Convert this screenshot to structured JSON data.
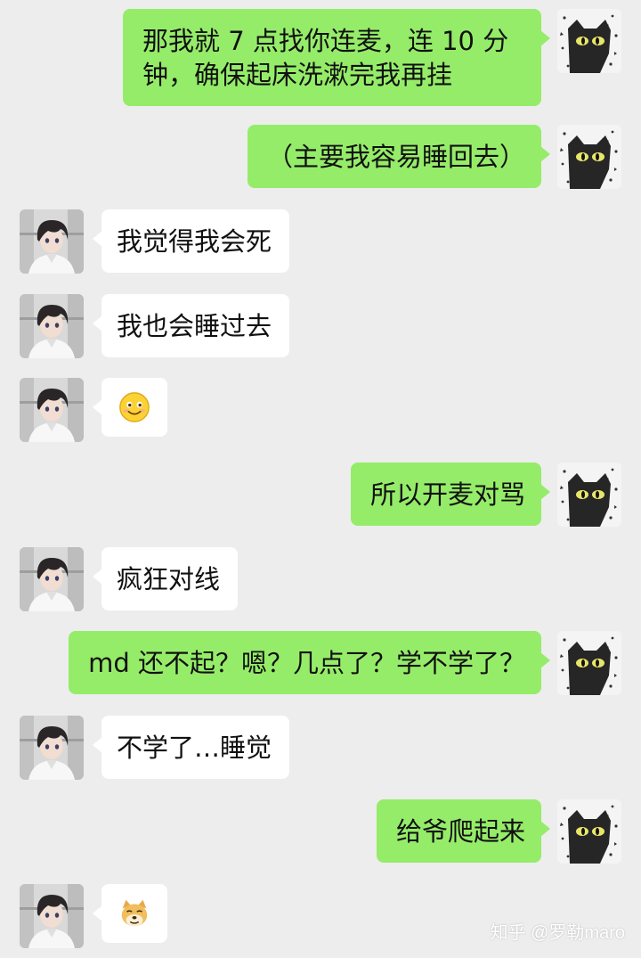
{
  "app": {
    "background": "#ededed",
    "sent_bubble_color": "#95ec69",
    "received_bubble_color": "#ffffff"
  },
  "messages": [
    {
      "side": "me",
      "avatar": "cat-avatar",
      "text": "那我就 7 点找你连麦，连 10 分钟，确保起床洗漱完我再挂"
    },
    {
      "side": "me",
      "avatar": "cat-avatar",
      "text": "（主要我容易睡回去）"
    },
    {
      "side": "other",
      "avatar": "anime-boy-avatar",
      "text": "我觉得我会死"
    },
    {
      "side": "other",
      "avatar": "anime-boy-avatar",
      "text": "我也会睡过去"
    },
    {
      "side": "other",
      "avatar": "anime-boy-avatar",
      "emoji": "smile-emoji"
    },
    {
      "side": "me",
      "avatar": "cat-avatar",
      "text": "所以开麦对骂"
    },
    {
      "side": "other",
      "avatar": "anime-boy-avatar",
      "text": "疯狂对线"
    },
    {
      "side": "me",
      "avatar": "cat-avatar",
      "text": "md 还不起？嗯？几点了？学不学了？"
    },
    {
      "side": "other",
      "avatar": "anime-boy-avatar",
      "text": "不学了…睡觉"
    },
    {
      "side": "me",
      "avatar": "cat-avatar",
      "text": "给爷爬起来"
    },
    {
      "side": "other",
      "avatar": "anime-boy-avatar",
      "emoji": "doge-emoji"
    }
  ],
  "watermark": "知乎 @罗勒maro"
}
